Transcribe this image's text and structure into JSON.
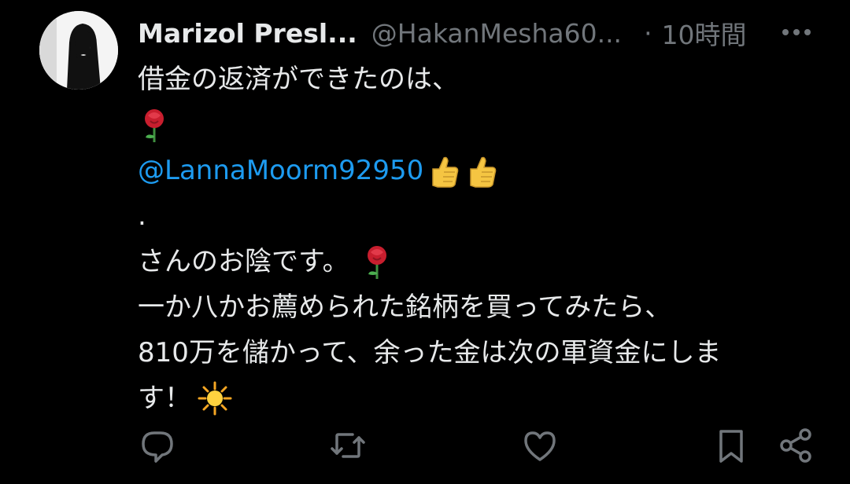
{
  "tweet": {
    "display_name": "Marizol Presl...",
    "handle": "@HakanMesha60...",
    "separator": "·",
    "time": "10時間",
    "lines": {
      "l1": "借金の返済ができたのは、",
      "mention": "@LannaMoorm92950",
      "l4": ".",
      "l5": "さんのお陰です。",
      "l6": "一か八かお薦められた銘柄を買ってみたら、",
      "l7": "810万を儲かって、余った金は次の軍資金にしま",
      "l8": "す！"
    },
    "emojis": [
      "rose",
      "thumbs-up",
      "thumbs-up",
      "rose",
      "sun"
    ]
  },
  "actions": [
    "reply",
    "retweet",
    "like",
    "bookmark",
    "share"
  ],
  "colors": {
    "background": "#000000",
    "text": "#e7e9ea",
    "muted": "#71767b",
    "link": "#1d9bf0"
  }
}
